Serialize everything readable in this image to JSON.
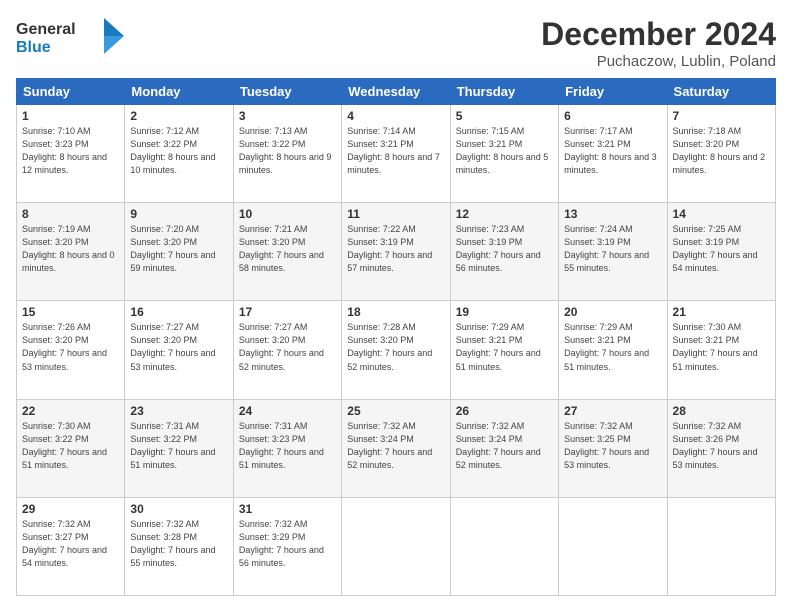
{
  "header": {
    "logo_line1": "General",
    "logo_line2": "Blue",
    "month_title": "December 2024",
    "location": "Puchaczow, Lublin, Poland"
  },
  "weekdays": [
    "Sunday",
    "Monday",
    "Tuesday",
    "Wednesday",
    "Thursday",
    "Friday",
    "Saturday"
  ],
  "weeks": [
    [
      {
        "day": "1",
        "sunrise": "Sunrise: 7:10 AM",
        "sunset": "Sunset: 3:23 PM",
        "daylight": "Daylight: 8 hours and 12 minutes."
      },
      {
        "day": "2",
        "sunrise": "Sunrise: 7:12 AM",
        "sunset": "Sunset: 3:22 PM",
        "daylight": "Daylight: 8 hours and 10 minutes."
      },
      {
        "day": "3",
        "sunrise": "Sunrise: 7:13 AM",
        "sunset": "Sunset: 3:22 PM",
        "daylight": "Daylight: 8 hours and 9 minutes."
      },
      {
        "day": "4",
        "sunrise": "Sunrise: 7:14 AM",
        "sunset": "Sunset: 3:21 PM",
        "daylight": "Daylight: 8 hours and 7 minutes."
      },
      {
        "day": "5",
        "sunrise": "Sunrise: 7:15 AM",
        "sunset": "Sunset: 3:21 PM",
        "daylight": "Daylight: 8 hours and 5 minutes."
      },
      {
        "day": "6",
        "sunrise": "Sunrise: 7:17 AM",
        "sunset": "Sunset: 3:21 PM",
        "daylight": "Daylight: 8 hours and 3 minutes."
      },
      {
        "day": "7",
        "sunrise": "Sunrise: 7:18 AM",
        "sunset": "Sunset: 3:20 PM",
        "daylight": "Daylight: 8 hours and 2 minutes."
      }
    ],
    [
      {
        "day": "8",
        "sunrise": "Sunrise: 7:19 AM",
        "sunset": "Sunset: 3:20 PM",
        "daylight": "Daylight: 8 hours and 0 minutes."
      },
      {
        "day": "9",
        "sunrise": "Sunrise: 7:20 AM",
        "sunset": "Sunset: 3:20 PM",
        "daylight": "Daylight: 7 hours and 59 minutes."
      },
      {
        "day": "10",
        "sunrise": "Sunrise: 7:21 AM",
        "sunset": "Sunset: 3:20 PM",
        "daylight": "Daylight: 7 hours and 58 minutes."
      },
      {
        "day": "11",
        "sunrise": "Sunrise: 7:22 AM",
        "sunset": "Sunset: 3:19 PM",
        "daylight": "Daylight: 7 hours and 57 minutes."
      },
      {
        "day": "12",
        "sunrise": "Sunrise: 7:23 AM",
        "sunset": "Sunset: 3:19 PM",
        "daylight": "Daylight: 7 hours and 56 minutes."
      },
      {
        "day": "13",
        "sunrise": "Sunrise: 7:24 AM",
        "sunset": "Sunset: 3:19 PM",
        "daylight": "Daylight: 7 hours and 55 minutes."
      },
      {
        "day": "14",
        "sunrise": "Sunrise: 7:25 AM",
        "sunset": "Sunset: 3:19 PM",
        "daylight": "Daylight: 7 hours and 54 minutes."
      }
    ],
    [
      {
        "day": "15",
        "sunrise": "Sunrise: 7:26 AM",
        "sunset": "Sunset: 3:20 PM",
        "daylight": "Daylight: 7 hours and 53 minutes."
      },
      {
        "day": "16",
        "sunrise": "Sunrise: 7:27 AM",
        "sunset": "Sunset: 3:20 PM",
        "daylight": "Daylight: 7 hours and 53 minutes."
      },
      {
        "day": "17",
        "sunrise": "Sunrise: 7:27 AM",
        "sunset": "Sunset: 3:20 PM",
        "daylight": "Daylight: 7 hours and 52 minutes."
      },
      {
        "day": "18",
        "sunrise": "Sunrise: 7:28 AM",
        "sunset": "Sunset: 3:20 PM",
        "daylight": "Daylight: 7 hours and 52 minutes."
      },
      {
        "day": "19",
        "sunrise": "Sunrise: 7:29 AM",
        "sunset": "Sunset: 3:21 PM",
        "daylight": "Daylight: 7 hours and 51 minutes."
      },
      {
        "day": "20",
        "sunrise": "Sunrise: 7:29 AM",
        "sunset": "Sunset: 3:21 PM",
        "daylight": "Daylight: 7 hours and 51 minutes."
      },
      {
        "day": "21",
        "sunrise": "Sunrise: 7:30 AM",
        "sunset": "Sunset: 3:21 PM",
        "daylight": "Daylight: 7 hours and 51 minutes."
      }
    ],
    [
      {
        "day": "22",
        "sunrise": "Sunrise: 7:30 AM",
        "sunset": "Sunset: 3:22 PM",
        "daylight": "Daylight: 7 hours and 51 minutes."
      },
      {
        "day": "23",
        "sunrise": "Sunrise: 7:31 AM",
        "sunset": "Sunset: 3:22 PM",
        "daylight": "Daylight: 7 hours and 51 minutes."
      },
      {
        "day": "24",
        "sunrise": "Sunrise: 7:31 AM",
        "sunset": "Sunset: 3:23 PM",
        "daylight": "Daylight: 7 hours and 51 minutes."
      },
      {
        "day": "25",
        "sunrise": "Sunrise: 7:32 AM",
        "sunset": "Sunset: 3:24 PM",
        "daylight": "Daylight: 7 hours and 52 minutes."
      },
      {
        "day": "26",
        "sunrise": "Sunrise: 7:32 AM",
        "sunset": "Sunset: 3:24 PM",
        "daylight": "Daylight: 7 hours and 52 minutes."
      },
      {
        "day": "27",
        "sunrise": "Sunrise: 7:32 AM",
        "sunset": "Sunset: 3:25 PM",
        "daylight": "Daylight: 7 hours and 53 minutes."
      },
      {
        "day": "28",
        "sunrise": "Sunrise: 7:32 AM",
        "sunset": "Sunset: 3:26 PM",
        "daylight": "Daylight: 7 hours and 53 minutes."
      }
    ],
    [
      {
        "day": "29",
        "sunrise": "Sunrise: 7:32 AM",
        "sunset": "Sunset: 3:27 PM",
        "daylight": "Daylight: 7 hours and 54 minutes."
      },
      {
        "day": "30",
        "sunrise": "Sunrise: 7:32 AM",
        "sunset": "Sunset: 3:28 PM",
        "daylight": "Daylight: 7 hours and 55 minutes."
      },
      {
        "day": "31",
        "sunrise": "Sunrise: 7:32 AM",
        "sunset": "Sunset: 3:29 PM",
        "daylight": "Daylight: 7 hours and 56 minutes."
      },
      null,
      null,
      null,
      null
    ]
  ]
}
